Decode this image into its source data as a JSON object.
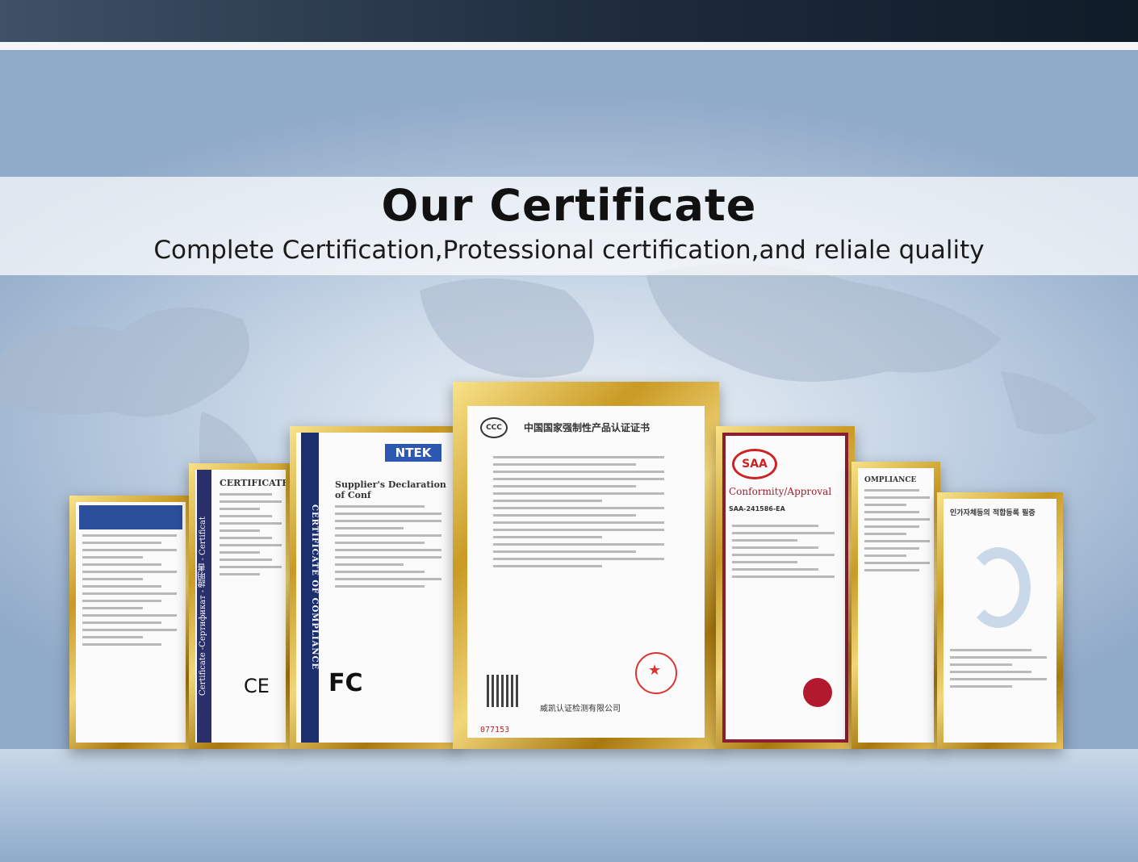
{
  "header": {
    "title": "Our Certificate",
    "subtitle": "Complete Certification,Protessional certification,and reliale quality"
  },
  "certificates": {
    "cert_2": {
      "heading": "CERTIFICATE",
      "side_text": "Certificate -Сертификат - 證明書 - Certificat",
      "mark": "CE"
    },
    "cert_3": {
      "logo": "NTEK",
      "side_text": "CERTIFICATE OF COMPLIANCE",
      "heading": "Supplier's Declaration of Conf",
      "mark": "FC"
    },
    "cert_4": {
      "logo": "CCC",
      "heading": "中国国家强制性产品认证证书",
      "number": "077153",
      "issuer": "威凯认证检测有限公司"
    },
    "cert_5": {
      "logo": "SAA",
      "heading": "Conformity/Approval",
      "number": "SAA-241586-EA"
    },
    "cert_6": {
      "heading": "OMPLIANCE"
    },
    "cert_7": {
      "heading": "인가자체등의 적합등록 필증"
    }
  },
  "colors": {
    "topbar": "#1d2b3c",
    "gold": "#c99a24",
    "title": "#111111"
  }
}
